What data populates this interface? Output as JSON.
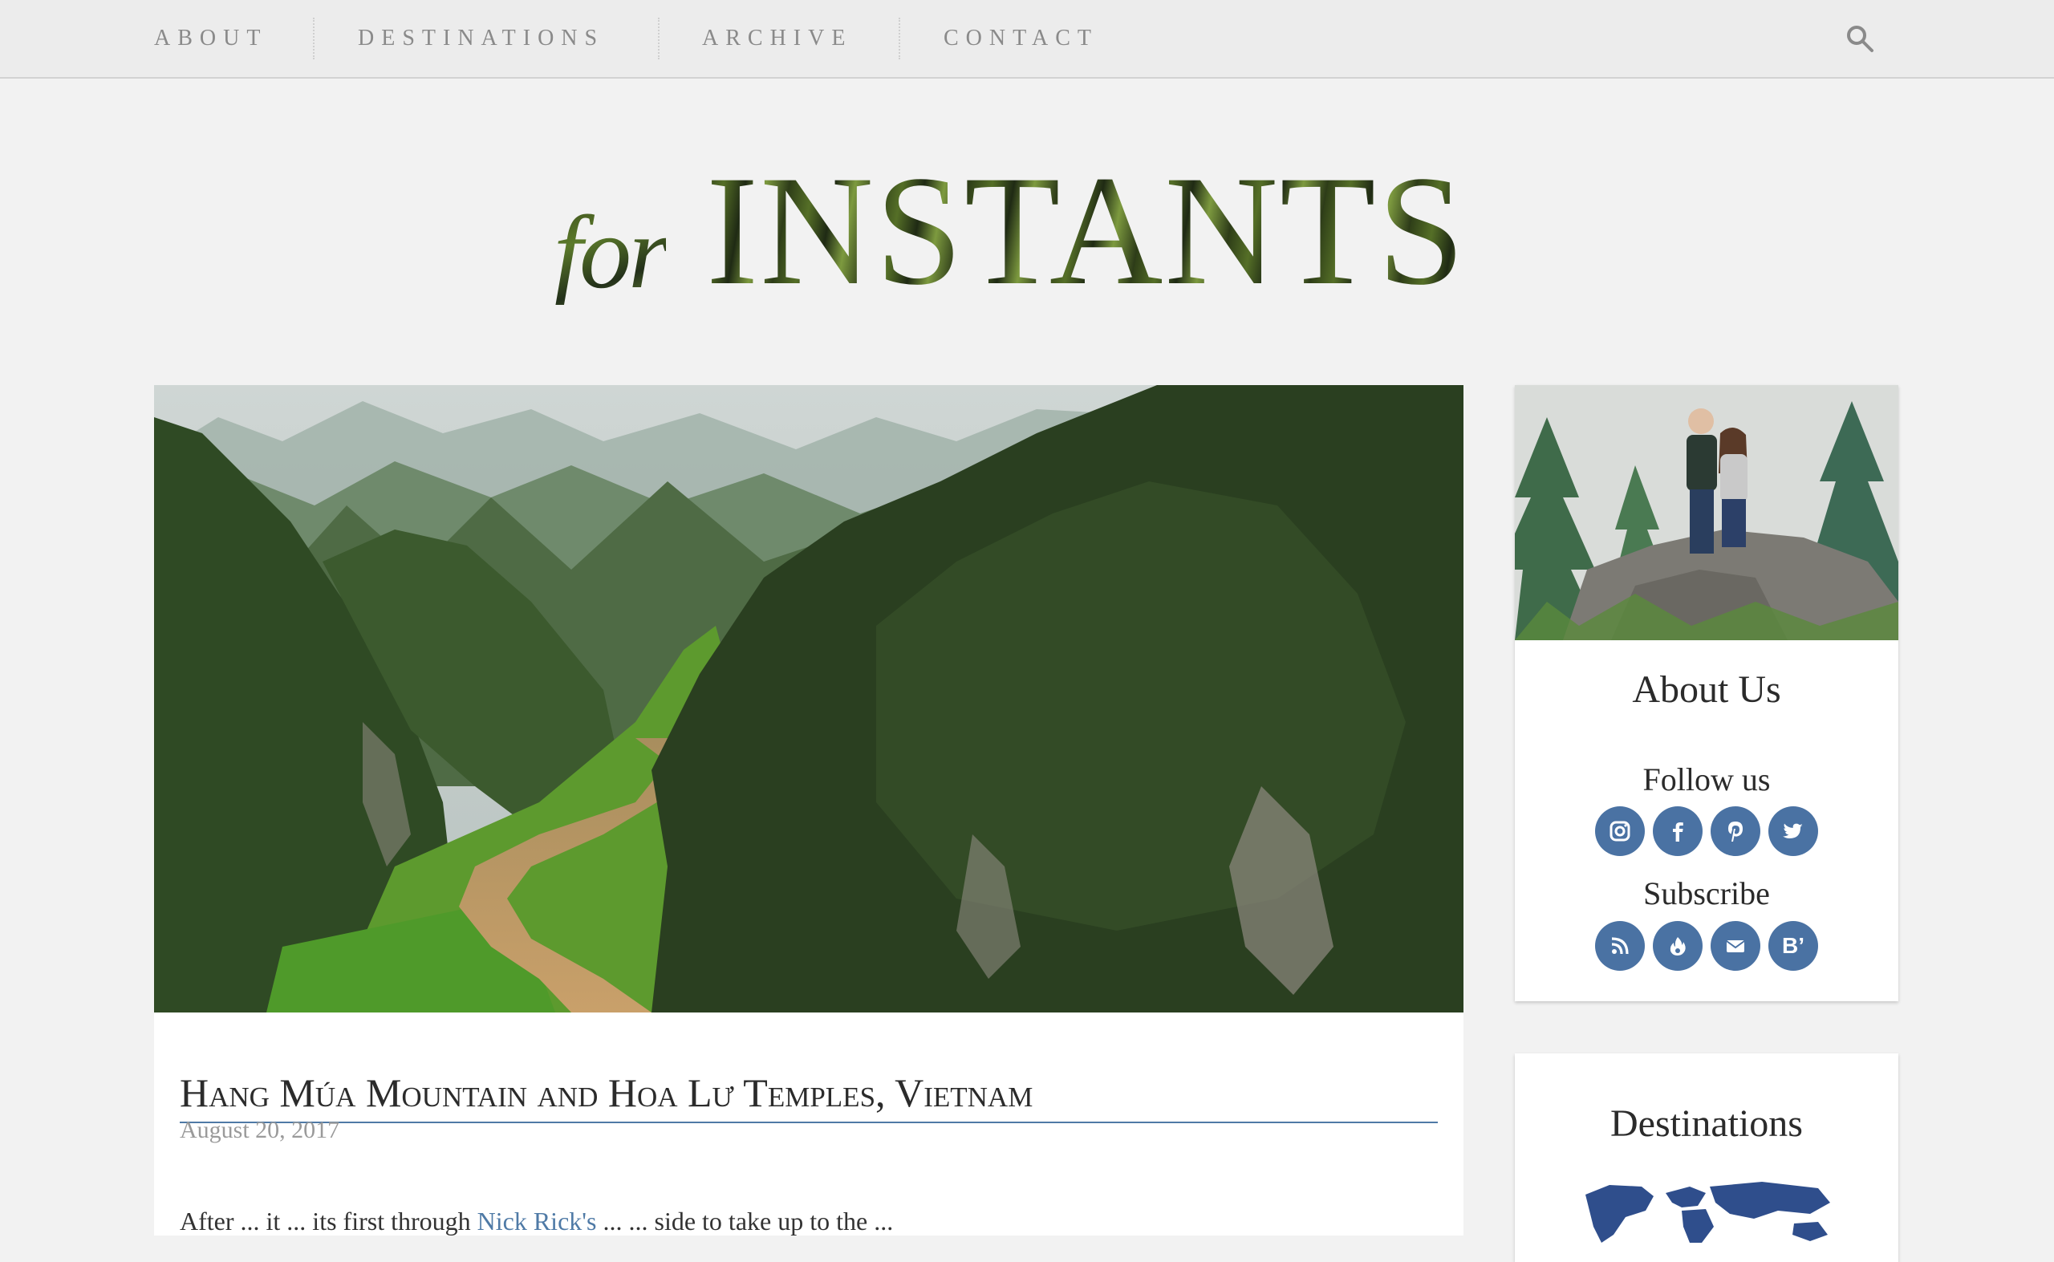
{
  "nav": {
    "items": [
      {
        "label": "ABOUT"
      },
      {
        "label": "DESTINATIONS"
      },
      {
        "label": "ARCHIVE"
      },
      {
        "label": "CONTACT"
      }
    ],
    "search_icon": "search-icon"
  },
  "logo": {
    "prefix": "for",
    "main": "INSTANTS"
  },
  "post": {
    "title": "Hang Múa Mountain and Hoa Lư Temples, Vietnam",
    "date": "August 20, 2017",
    "excerpt_start": "After ... it ... its first through",
    "excerpt_link": "Nick Rick's",
    "excerpt_end": "... ... side to take up to the ...",
    "image_alt": "karst-mountains-river-valley"
  },
  "sidebar": {
    "about": {
      "heading": "About Us",
      "follow_heading": "Follow us",
      "follow_icons": [
        "instagram-icon",
        "facebook-icon",
        "pinterest-icon",
        "twitter-icon"
      ],
      "subscribe_heading": "Subscribe",
      "subscribe_icons": [
        "rss-icon",
        "feed-flame-icon",
        "email-icon",
        "bloglovin-icon"
      ]
    },
    "destinations": {
      "heading": "Destinations",
      "map_icon": "world-map"
    }
  },
  "colors": {
    "accent": "#4a72a3",
    "link": "#4f7aa6",
    "background": "#f2f2f2"
  }
}
